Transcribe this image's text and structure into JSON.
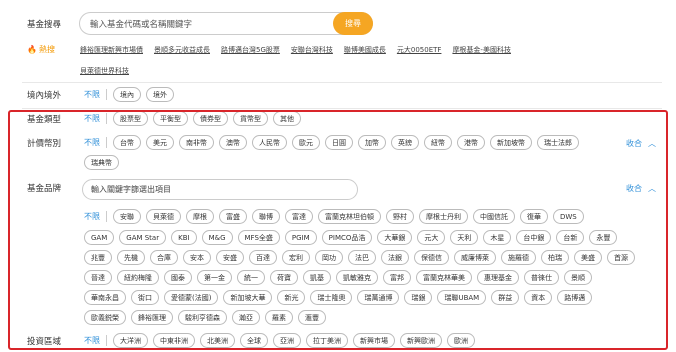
{
  "search": {
    "label": "基金搜尋",
    "placeholder": "輸入基金代碼或名稱關鍵字",
    "button": "搜尋"
  },
  "hot": {
    "label": "熱搜",
    "links": [
      "鋒裕匯理新興市場債",
      "景順多元收益成長",
      "路博邁台灣5G股票",
      "安聯台灣科技",
      "聯博美國成長",
      "元大0050ETF",
      "摩根基金-美國科技"
    ],
    "links2": [
      "貝萊德世界科技"
    ]
  },
  "region": {
    "label": "境內境外",
    "unlimited": "不限",
    "options": [
      "境內",
      "境外"
    ]
  },
  "type": {
    "label": "基金類型",
    "unlimited": "不限",
    "options": [
      "股票型",
      "平衡型",
      "債券型",
      "貨幣型",
      "其他"
    ]
  },
  "currency": {
    "label": "計價幣別",
    "unlimited": "不限",
    "options": [
      "台幣",
      "美元",
      "南非幣",
      "澳幣",
      "人民幣",
      "歐元",
      "日圓",
      "加幣",
      "英鎊",
      "紐幣",
      "港幣",
      "新加坡幣",
      "瑞士法郎"
    ],
    "options2": [
      "瑞典幣"
    ],
    "collapse": "收合"
  },
  "brand": {
    "label": "基金品牌",
    "search_placeholder": "輸入關鍵字篩選出項目",
    "collapse": "收合",
    "unlimited": "不限",
    "lines": [
      [
        "安聯",
        "貝萊德",
        "摩根",
        "富盛",
        "聯博",
        "富達",
        "富蘭克林坦伯頓",
        "野村",
        "摩根士丹利",
        "中國信託",
        "復華",
        "DWS"
      ],
      [
        "GAM",
        "GAM Star",
        "KBI",
        "M&G",
        "MFS全盛",
        "PGIM",
        "PIMCO品浩",
        "大華銀",
        "元大",
        "天利",
        "木星",
        "台中銀",
        "台新",
        "永豐"
      ],
      [
        "兆豐",
        "先機",
        "合庫",
        "安本",
        "安盛",
        "百達",
        "宏利",
        "岡功",
        "法巴",
        "法銀",
        "保德信",
        "威廉博萊",
        "施羅德",
        "柏瑞",
        "美盛",
        "首源"
      ],
      [
        "晉達",
        "紐約梅隆",
        "國泰",
        "第一金",
        "統一",
        "荷寶",
        "凱基",
        "凱敏雅克",
        "富邦",
        "富蘭克林華美",
        "惠理基金",
        "普徠仕",
        "景順"
      ],
      [
        "華南永昌",
        "街口",
        "愛德蒙(法國)",
        "新加坡大華",
        "新光",
        "瑞士隆奧",
        "瑞萬通博",
        "瑞銀",
        "瑞聯UBAM",
        "群益",
        "資本",
        "路博邁"
      ],
      [
        "歐義鋭榮",
        "鋒裕匯理",
        "駿利亨德森",
        "瀚亞",
        "羅素",
        "滙豐"
      ]
    ]
  },
  "area": {
    "label": "投資區域",
    "unlimited": "不限",
    "options": [
      "大洋洲",
      "中東非洲",
      "北美洲",
      "全球",
      "亞洲",
      "拉丁美洲",
      "新興市場",
      "新興歐洲",
      "歐洲"
    ]
  },
  "colors": {
    "accent": "#f5a623",
    "link_blue": "#2f8fd8",
    "highlight_red": "#d9252a"
  }
}
